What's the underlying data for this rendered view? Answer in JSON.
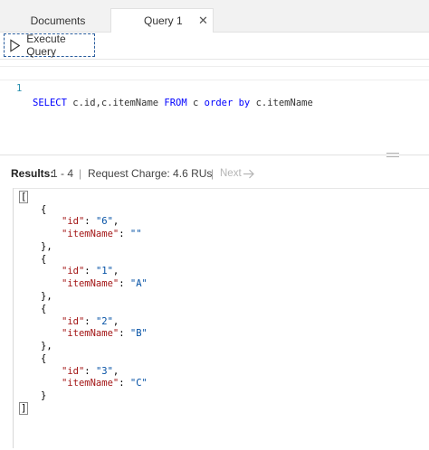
{
  "tabs": [
    {
      "label": "Documents",
      "active": false
    },
    {
      "label": "Query 1",
      "active": true,
      "close_glyph": "✕"
    }
  ],
  "toolbar": {
    "execute_label": "Execute Query",
    "execute_icon": "play-icon"
  },
  "editor": {
    "line_number": "1",
    "tokens": {
      "select": "SELECT",
      "fields": " c.id,c.itemName ",
      "from": "FROM",
      "alias": " c ",
      "order_by": "order by",
      "order_field": " c.itemName"
    }
  },
  "results": {
    "title": "Results:",
    "range": "1 - 4",
    "separator": "|",
    "charge": "Request Charge: 4.6 RUs",
    "next_label": "Next",
    "next_icon": "arrow-right-icon",
    "colors": {
      "key": "#a31515",
      "string": "#0451a5",
      "keyword": "#0000ff",
      "line_number": "#2b91af"
    }
  },
  "json": {
    "open_bracket": "[",
    "close_bracket": "]",
    "open_brace": "{",
    "close_brace": "}",
    "close_brace_comma": "},",
    "items": [
      {
        "id_key": "\"id\"",
        "id_val": "\"6\"",
        "name_key": "\"itemName\"",
        "name_val": "\"\""
      },
      {
        "id_key": "\"id\"",
        "id_val": "\"1\"",
        "name_key": "\"itemName\"",
        "name_val": "\"A\""
      },
      {
        "id_key": "\"id\"",
        "id_val": "\"2\"",
        "name_key": "\"itemName\"",
        "name_val": "\"B\""
      },
      {
        "id_key": "\"id\"",
        "id_val": "\"3\"",
        "name_key": "\"itemName\"",
        "name_val": "\"C\""
      }
    ]
  }
}
